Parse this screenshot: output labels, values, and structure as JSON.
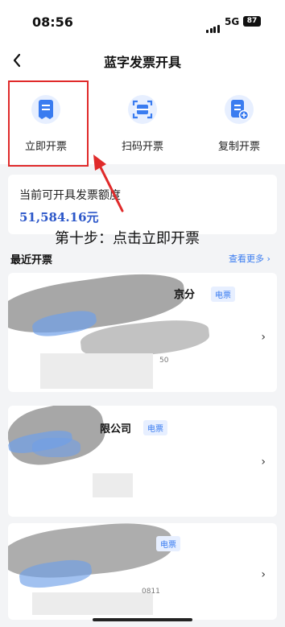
{
  "status_bar": {
    "time": "08:56",
    "network": "5G",
    "battery": "87"
  },
  "nav": {
    "title": "蓝字发票开具"
  },
  "actions": [
    {
      "label": "立即开票",
      "icon": "invoice-icon"
    },
    {
      "label": "扫码开票",
      "icon": "scan-icon"
    },
    {
      "label": "复制开票",
      "icon": "copy-invoice-icon"
    }
  ],
  "quota": {
    "label": "当前可开具发票额度",
    "value": "51,584.16元"
  },
  "annotation": "第十步：点击立即开票",
  "recent": {
    "title": "最近开票",
    "more": "查看更多 ›",
    "items": [
      {
        "name_suffix": "京分",
        "tag": "电票",
        "faint": "50"
      },
      {
        "name_suffix": "限公司",
        "tag": "电票",
        "faint": ""
      },
      {
        "name_suffix": "",
        "tag": "电票",
        "faint": "0811"
      }
    ]
  },
  "colors": {
    "accent": "#3a7cf0",
    "highlight_box": "#e02a2a",
    "quota_value": "#2c57c9"
  }
}
